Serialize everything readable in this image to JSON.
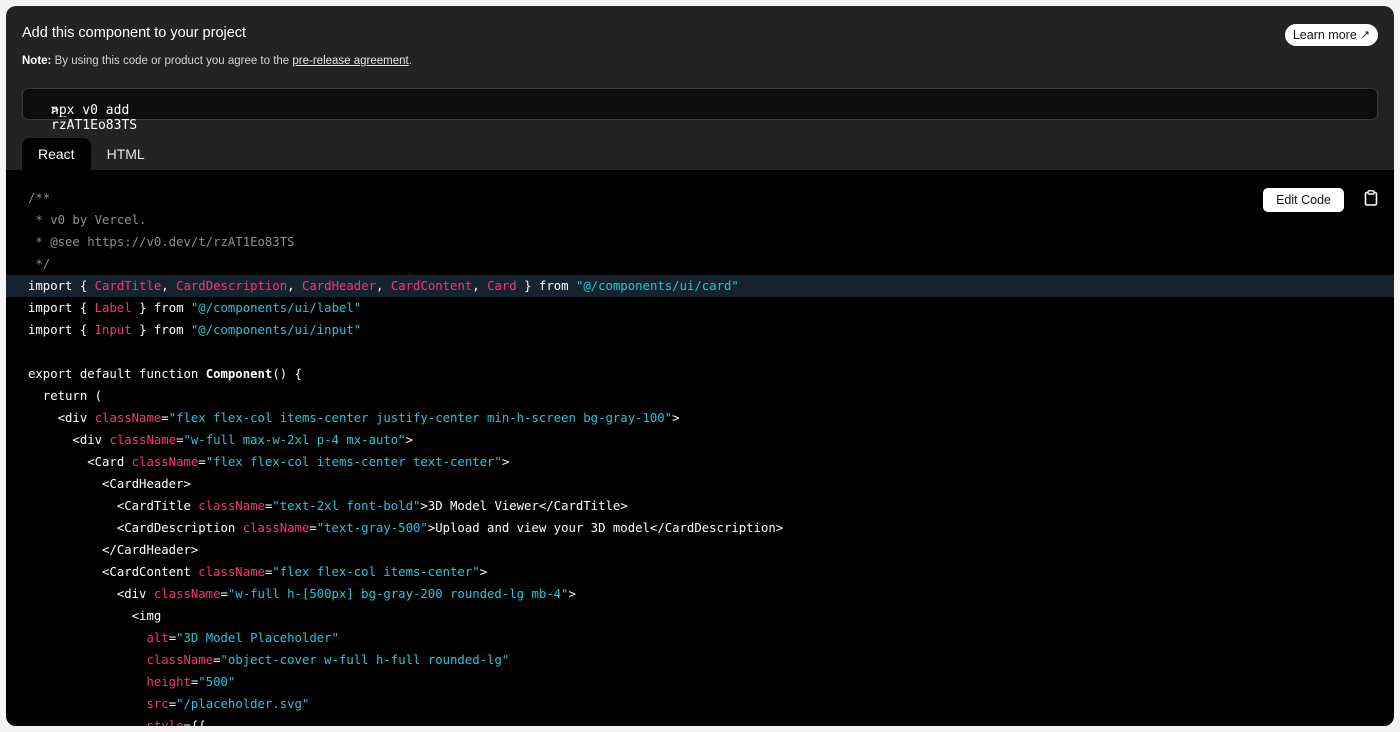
{
  "header": {
    "title": "Add this component to your project",
    "learn_more": "Learn more",
    "note_label": "Note:",
    "note_text": " By using this code or product you agree to the ",
    "note_link": "pre-release agreement",
    "note_end": "."
  },
  "command": {
    "text": "npx v0 add rzAT1Eo83TS"
  },
  "tabs": [
    "React",
    "HTML"
  ],
  "toolbar": {
    "edit_code": "Edit Code"
  },
  "code_lines": [
    [
      [
        "c",
        "/**"
      ]
    ],
    [
      [
        "c",
        " * v0 by Vercel."
      ]
    ],
    [
      [
        "c",
        " * @see https://v0.dev/t/rzAT1Eo83TS"
      ]
    ],
    [
      [
        "c",
        " */"
      ]
    ],
    [
      [
        "k",
        "import { "
      ],
      [
        "p",
        "CardTitle"
      ],
      [
        "k",
        ", "
      ],
      [
        "p",
        "CardDescription"
      ],
      [
        "k",
        ", "
      ],
      [
        "p",
        "CardHeader"
      ],
      [
        "k",
        ", "
      ],
      [
        "p",
        "CardContent"
      ],
      [
        "k",
        ", "
      ],
      [
        "p",
        "Card"
      ],
      [
        "k",
        " } from "
      ],
      [
        "s",
        "\"@/components/ui/card\""
      ]
    ],
    [
      [
        "k",
        "import { "
      ],
      [
        "p",
        "Label"
      ],
      [
        "k",
        " } from "
      ],
      [
        "s",
        "\"@/components/ui/label\""
      ]
    ],
    [
      [
        "k",
        "import { "
      ],
      [
        "p",
        "Input"
      ],
      [
        "k",
        " } from "
      ],
      [
        "s",
        "\"@/components/ui/input\""
      ]
    ],
    [
      [
        "w",
        ""
      ]
    ],
    [
      [
        "k",
        "export default function "
      ],
      [
        "b",
        "Component"
      ],
      [
        "k",
        "() {"
      ]
    ],
    [
      [
        "k",
        "  return ("
      ]
    ],
    [
      [
        "k",
        "    <div "
      ],
      [
        "p",
        "className"
      ],
      [
        "k",
        "="
      ],
      [
        "s",
        "\"flex flex-col items-center justify-center min-h-screen bg-gray-100\""
      ],
      [
        "k",
        ">"
      ]
    ],
    [
      [
        "k",
        "      <div "
      ],
      [
        "p",
        "className"
      ],
      [
        "k",
        "="
      ],
      [
        "s",
        "\"w-full max-w-2xl p-4 mx-auto\""
      ],
      [
        "k",
        ">"
      ]
    ],
    [
      [
        "k",
        "        <Card "
      ],
      [
        "p",
        "className"
      ],
      [
        "k",
        "="
      ],
      [
        "s",
        "\"flex flex-col items-center text-center\""
      ],
      [
        "k",
        ">"
      ]
    ],
    [
      [
        "k",
        "          <CardHeader>"
      ]
    ],
    [
      [
        "k",
        "            <CardTitle "
      ],
      [
        "p",
        "className"
      ],
      [
        "k",
        "="
      ],
      [
        "s",
        "\"text-2xl font-bold\""
      ],
      [
        "k",
        ">3D Model Viewer</CardTitle>"
      ]
    ],
    [
      [
        "k",
        "            <CardDescription "
      ],
      [
        "p",
        "className"
      ],
      [
        "k",
        "="
      ],
      [
        "s",
        "\"text-gray-500\""
      ],
      [
        "k",
        ">Upload and view your 3D model</CardDescription>"
      ]
    ],
    [
      [
        "k",
        "          </CardHeader>"
      ]
    ],
    [
      [
        "k",
        "          <CardContent "
      ],
      [
        "p",
        "className"
      ],
      [
        "k",
        "="
      ],
      [
        "s",
        "\"flex flex-col items-center\""
      ],
      [
        "k",
        ">"
      ]
    ],
    [
      [
        "k",
        "            <div "
      ],
      [
        "p",
        "className"
      ],
      [
        "k",
        "="
      ],
      [
        "s",
        "\"w-full h-[500px] bg-gray-200 rounded-lg mb-4\""
      ],
      [
        "k",
        ">"
      ]
    ],
    [
      [
        "k",
        "              <img"
      ]
    ],
    [
      [
        "k",
        "                "
      ],
      [
        "p",
        "alt"
      ],
      [
        "k",
        "="
      ],
      [
        "s",
        "\"3D Model Placeholder\""
      ]
    ],
    [
      [
        "k",
        "                "
      ],
      [
        "p",
        "className"
      ],
      [
        "k",
        "="
      ],
      [
        "s",
        "\"object-cover w-full h-full rounded-lg\""
      ]
    ],
    [
      [
        "k",
        "                "
      ],
      [
        "p",
        "height"
      ],
      [
        "k",
        "="
      ],
      [
        "s",
        "\"500\""
      ]
    ],
    [
      [
        "k",
        "                "
      ],
      [
        "p",
        "src"
      ],
      [
        "k",
        "="
      ],
      [
        "s",
        "\"/placeholder.svg\""
      ]
    ],
    [
      [
        "k",
        "                "
      ],
      [
        "p",
        "style"
      ],
      [
        "k",
        "={{"
      ]
    ]
  ],
  "highlighted_line": 4
}
